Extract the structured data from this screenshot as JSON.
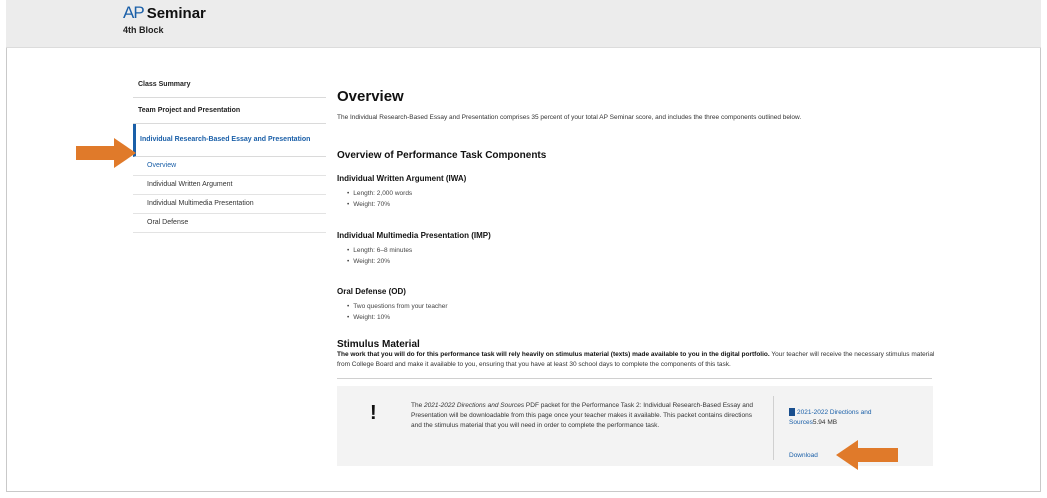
{
  "header": {
    "logo": "AP",
    "title": "Seminar",
    "subtitle": "4th Block"
  },
  "sidebar": {
    "items": [
      {
        "label": "Class Summary"
      },
      {
        "label": "Team Project and Presentation"
      },
      {
        "label": "Individual Research-Based Essay and Presentation"
      }
    ],
    "subitems": [
      {
        "label": "Overview"
      },
      {
        "label": "Individual Written Argument"
      },
      {
        "label": "Individual Multimedia Presentation"
      },
      {
        "label": "Oral Defense"
      }
    ]
  },
  "main": {
    "title": "Overview",
    "intro": "The Individual Research-Based Essay and Presentation comprises 35 percent of your total AP Seminar score, and includes the three components outlined below.",
    "components_heading": "Overview of Performance Task Components",
    "components": [
      {
        "title": "Individual Written Argument (IWA)",
        "bullets": [
          "Length: 2,000 words",
          "Weight: 70%"
        ]
      },
      {
        "title": "Individual Multimedia Presentation (IMP)",
        "bullets": [
          "Length: 6–8 minutes",
          "Weight: 20%"
        ]
      },
      {
        "title": "Oral Defense (OD)",
        "bullets": [
          "Two questions from your teacher",
          "Weight: 10%"
        ]
      }
    ],
    "stimulus": {
      "title": "Stimulus Material",
      "bold_text": "The work that you will do for this performance task will rely heavily on stimulus material (texts) made available to you in the digital portfolio.",
      "text": " Your teacher will receive the necessary stimulus material from College Board and make it available to you, ensuring that you have at least 30 school days to complete the components of this task."
    },
    "notice": {
      "icon": "!",
      "prefix": "The ",
      "doc_name": "2021-2022 Directions and Sources",
      "suffix": " PDF packet for the Performance Task 2: Individual Research-Based Essay and Presentation will be downloadable from this page once your teacher makes it available. This packet contains directions and the stimulus material that you will need in order to complete the performance task.",
      "file_name": "2021-2022 Directions and Sources",
      "file_size": "5.94 MB",
      "download_label": "Download"
    }
  },
  "colors": {
    "accent": "#1a5fa8",
    "arrow": "#e07a2a",
    "header_bg": "#ececec",
    "notice_bg": "#f3f3f3"
  }
}
